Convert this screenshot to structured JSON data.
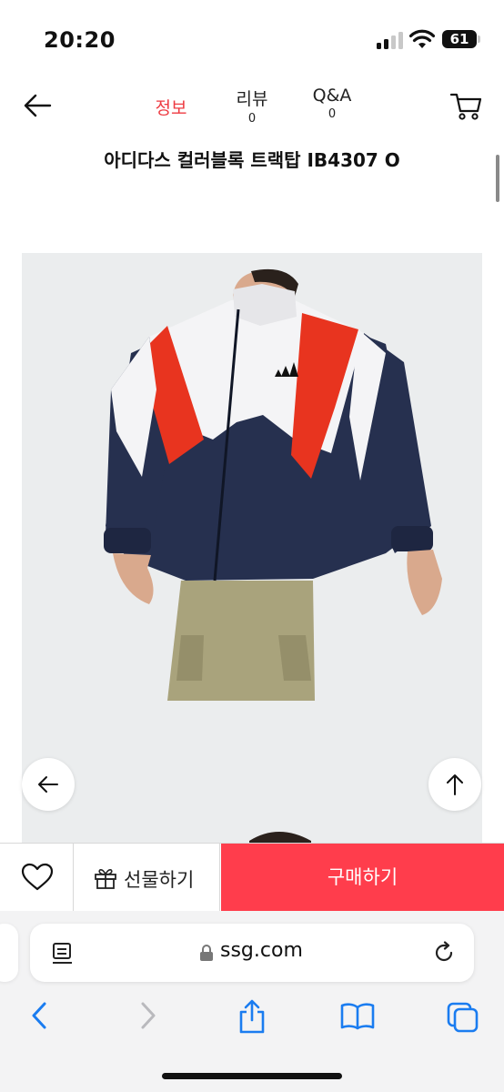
{
  "status_bar": {
    "time": "20:20",
    "battery_level": "61",
    "icons": [
      "cellular-signal-icon",
      "wifi-icon",
      "battery-icon"
    ]
  },
  "header": {
    "back_icon": "arrow-left-icon",
    "tabs": [
      {
        "label": "정보",
        "count": "",
        "active": true
      },
      {
        "label": "리뷰",
        "count": "0",
        "active": false
      },
      {
        "label": "Q&A",
        "count": "0",
        "active": false
      }
    ],
    "cart_icon": "shopping-cart-icon"
  },
  "product": {
    "title": "아디다스 컬러블록 트랙탑 IB4307 O",
    "image_icon": "product-photo-jacket"
  },
  "floating_buttons": {
    "prev_icon": "arrow-left-icon",
    "top_icon": "arrow-up-icon"
  },
  "buy_bar": {
    "wish_icon": "heart-icon",
    "gift_icon": "gift-icon",
    "gift_label": "선물하기",
    "purchase_label": "구매하기"
  },
  "browser": {
    "url": "ssg.com",
    "icons": [
      "reader-icon",
      "lock-icon",
      "reload-icon",
      "chevron-left-icon",
      "chevron-right-icon",
      "share-icon",
      "book-icon",
      "tabs-icon"
    ]
  },
  "colors": {
    "accent_red": "#ee3b42",
    "purchase_button": "#ff3d4c",
    "ios_blue": "#1a7cf0"
  }
}
